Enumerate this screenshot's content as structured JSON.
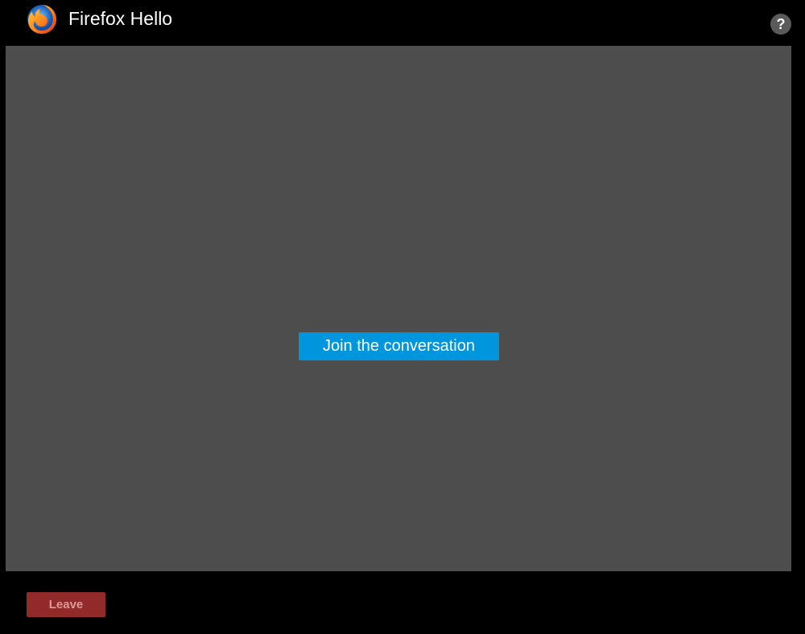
{
  "header": {
    "logo_icon": "firefox-logo-icon",
    "title": "Firefox Hello",
    "help_icon": "help-icon",
    "help_label": "?"
  },
  "main": {
    "join_button_label": "Join the conversation"
  },
  "footer": {
    "leave_button_label": "Leave"
  },
  "colors": {
    "background": "#000000",
    "video_area": "#4d4d4d",
    "join_button": "#0096dd",
    "leave_button": "#922a2a"
  }
}
